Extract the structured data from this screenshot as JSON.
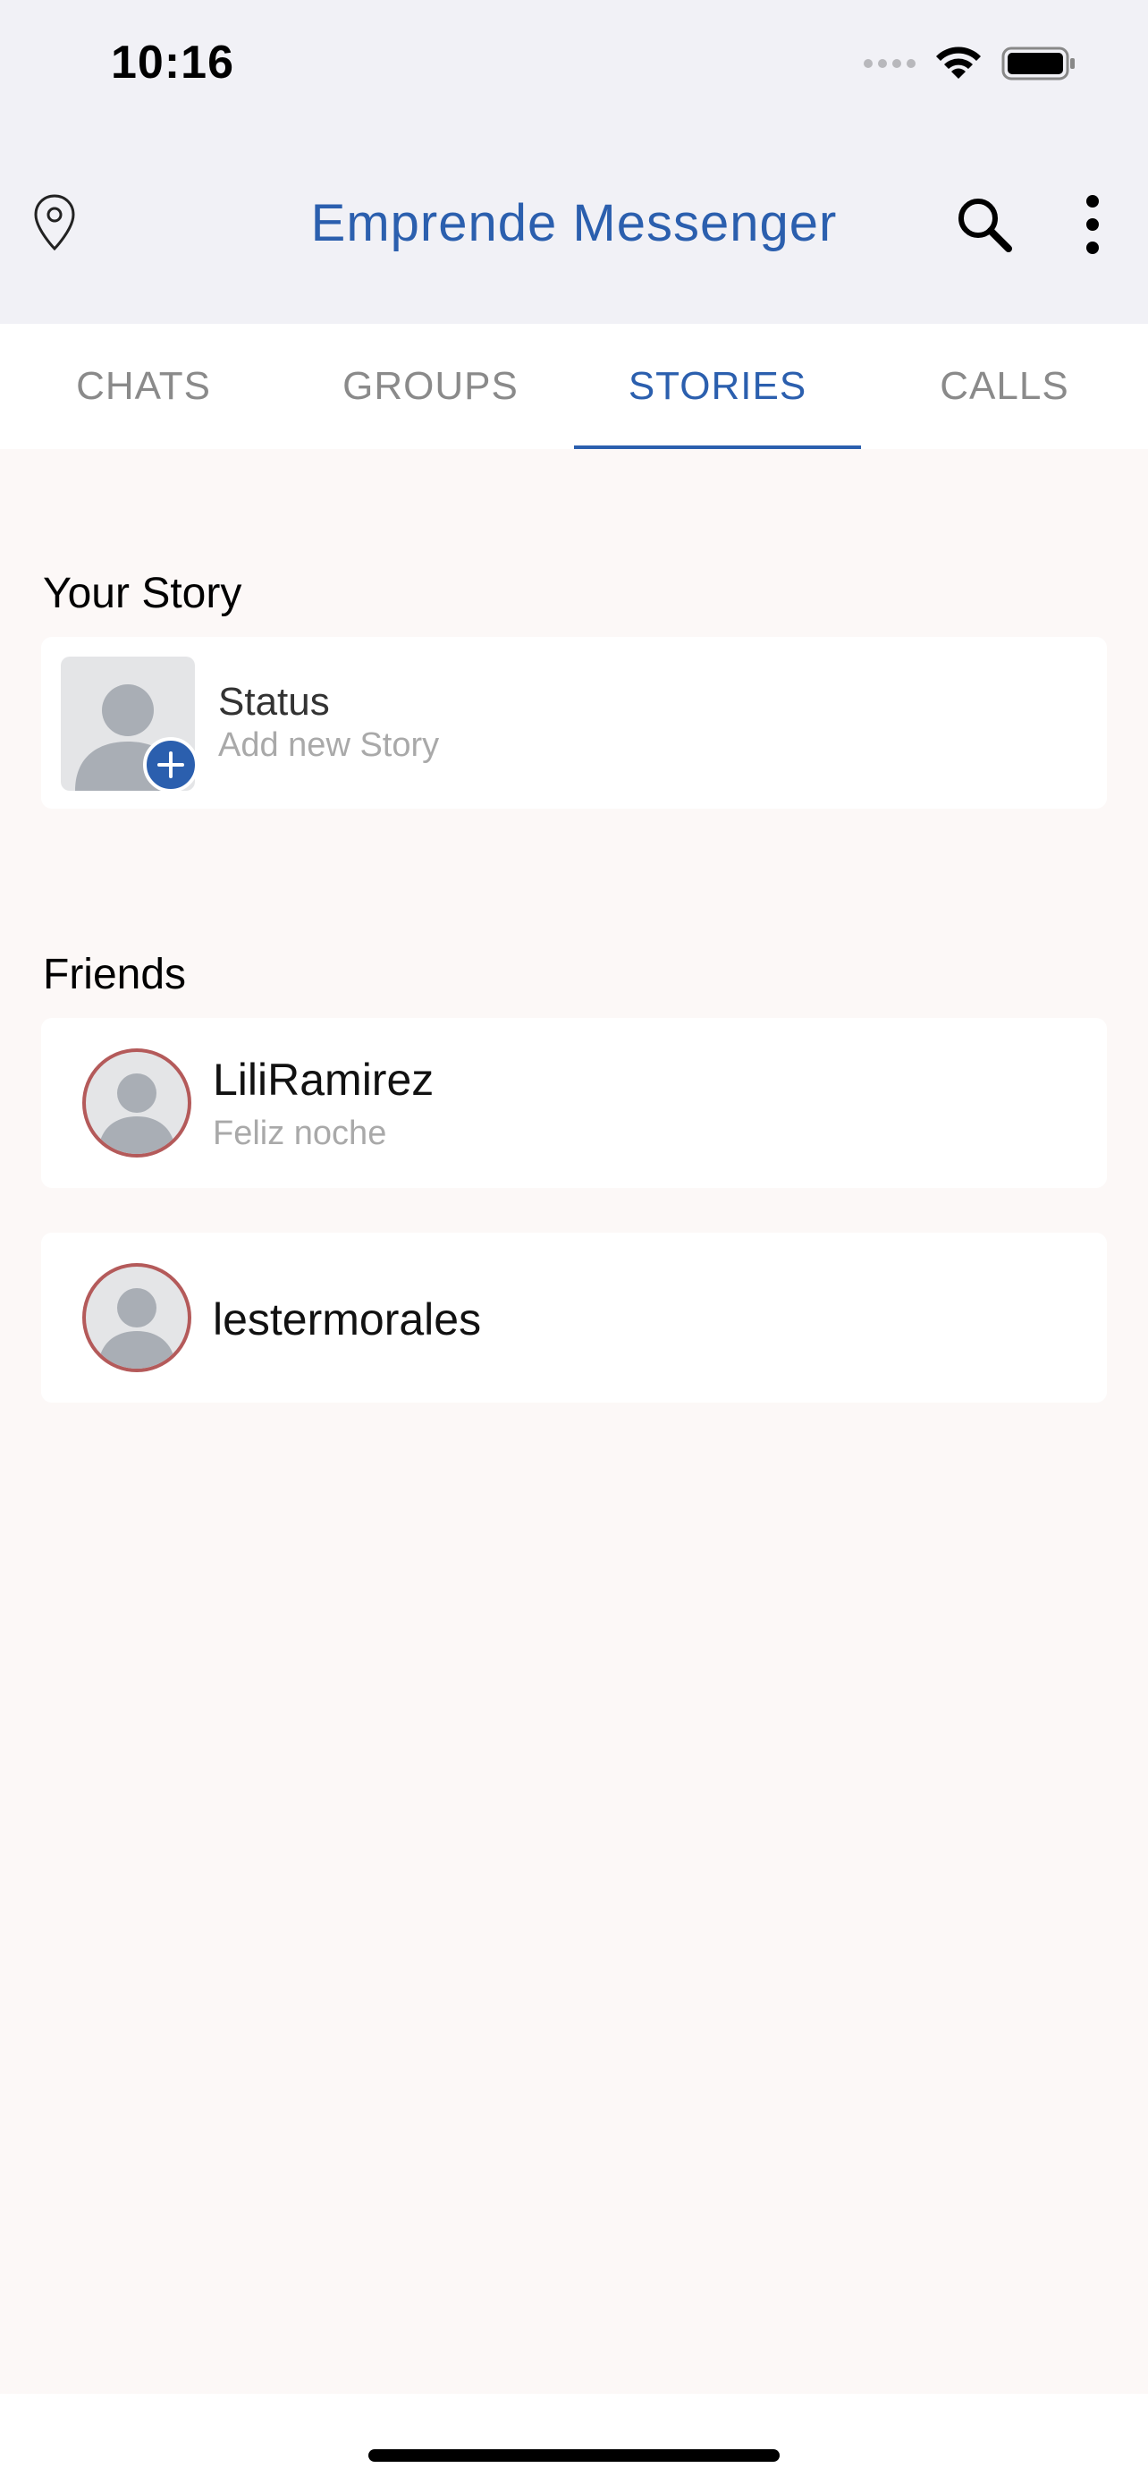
{
  "status_bar": {
    "time": "10:16",
    "icons": [
      "signal-dots-icon",
      "wifi-icon",
      "battery-icon"
    ]
  },
  "header": {
    "title": "Emprende Messenger",
    "left_icon": "location-pin-icon",
    "right_icons": [
      "search-icon",
      "more-vertical-icon"
    ],
    "accent_color": "#2b5fae"
  },
  "tabs": [
    {
      "label": "CHATS",
      "active": false
    },
    {
      "label": "GROUPS",
      "active": false
    },
    {
      "label": "STORIES",
      "active": true
    },
    {
      "label": "CALLS",
      "active": false
    }
  ],
  "your_story": {
    "section_title": "Your Story",
    "name": "Status",
    "subtitle": "Add new Story",
    "avatar_icon": "user-placeholder-icon",
    "badge_icon": "plus-icon"
  },
  "friends": {
    "section_title": "Friends",
    "items": [
      {
        "name": "LiliRamirez",
        "subtitle": "Feliz noche",
        "avatar_icon": "user-placeholder-icon"
      },
      {
        "name": "lestermorales",
        "subtitle": "",
        "avatar_icon": "user-placeholder-icon"
      }
    ],
    "ring_color": "#b45a5a"
  }
}
